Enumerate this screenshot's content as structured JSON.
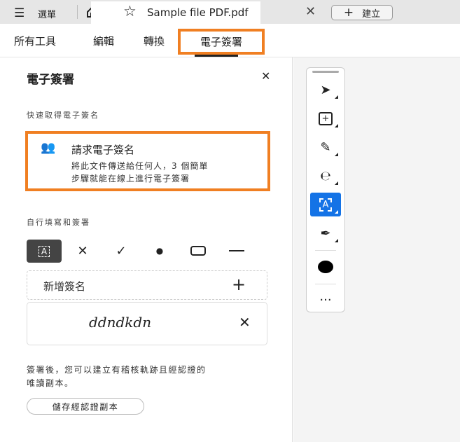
{
  "tabbar": {
    "menu_label": "選單",
    "doc_title": "Sample file PDF.pdf",
    "create_label": "建立"
  },
  "nav": {
    "items": [
      "所有工具",
      "編輯",
      "轉換",
      "電子簽署"
    ],
    "active": "電子簽署"
  },
  "panel": {
    "title": "電子簽署",
    "quick_heading": "快速取得電子簽名",
    "request": {
      "title": "請求電子簽名",
      "desc_line1": "將此文件傳送給任何人，3 個簡單",
      "desc_line2": "步驟就能在線上進行電子簽署"
    },
    "fill_heading": "自行填寫和簽署",
    "add_signature": "新增簽名",
    "signature_text": "ddndkdn",
    "note_line1": "簽署後，您可以建立有稽核軌跡且經認證的",
    "note_line2": "唯讀副本。",
    "save_button": "儲存經認證副本"
  },
  "colors": {
    "highlight": "#f07f22",
    "active_tool": "#1473e6"
  }
}
